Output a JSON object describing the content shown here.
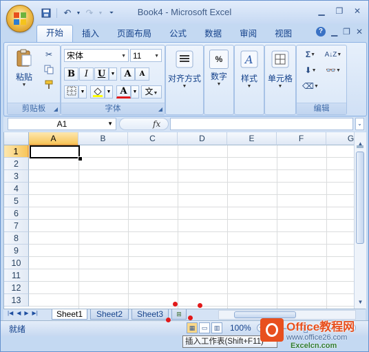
{
  "window": {
    "title": "Book4 - Microsoft Excel"
  },
  "qat": {
    "save": "save-icon",
    "undo": "undo-icon",
    "redo": "redo-icon",
    "customize": "customize-icon"
  },
  "tabs": [
    {
      "label": "开始",
      "active": true
    },
    {
      "label": "插入",
      "active": false
    },
    {
      "label": "页面布局",
      "active": false
    },
    {
      "label": "公式",
      "active": false
    },
    {
      "label": "数据",
      "active": false
    },
    {
      "label": "审阅",
      "active": false
    },
    {
      "label": "视图",
      "active": false
    }
  ],
  "ribbon": {
    "clipboard": {
      "label": "剪贴板",
      "paste": "粘贴"
    },
    "font": {
      "label": "字体",
      "name": "宋体",
      "size": "11",
      "bold": "B",
      "italic": "I",
      "underline": "U",
      "grow": "A",
      "shrink": "A",
      "font_color": "A",
      "phonetic": "文"
    },
    "alignment": {
      "label": "对齐方式"
    },
    "number": {
      "label": "数字",
      "symbol": "%"
    },
    "styles": {
      "label": "样式"
    },
    "cells": {
      "label": "单元格"
    },
    "editing": {
      "label": "编辑",
      "sum": "Σ"
    }
  },
  "formula_bar": {
    "name_box": "A1",
    "fx": "fx",
    "value": ""
  },
  "grid": {
    "columns": [
      "A",
      "B",
      "C",
      "D",
      "E",
      "F",
      "G"
    ],
    "rows": [
      "1",
      "2",
      "3",
      "4",
      "5",
      "6",
      "7",
      "8",
      "9",
      "10",
      "11",
      "12",
      "13"
    ],
    "selected_cell": "A1"
  },
  "sheets": [
    {
      "name": "Sheet1",
      "active": true
    },
    {
      "name": "Sheet2",
      "active": false
    },
    {
      "name": "Sheet3",
      "active": false
    }
  ],
  "status": {
    "ready": "就绪",
    "zoom": "100%"
  },
  "tooltip": "插入工作表(Shift+F11)",
  "watermark": {
    "brand": "Office教程网",
    "url": "www.office26.com",
    "site": "Excelcn.com"
  }
}
